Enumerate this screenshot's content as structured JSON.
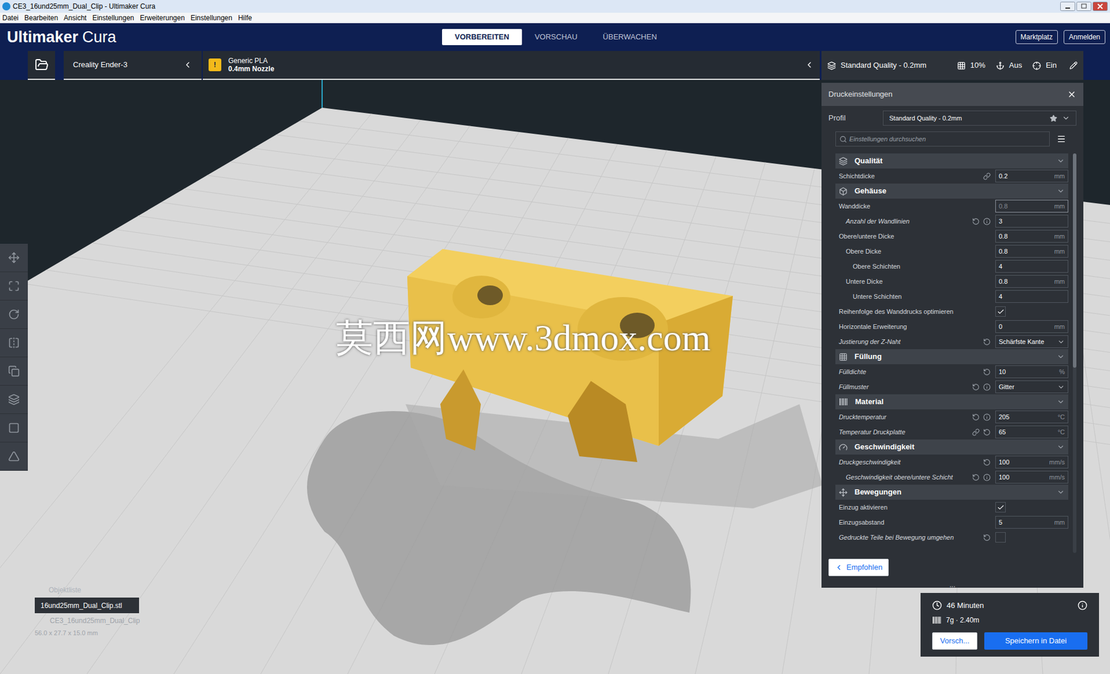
{
  "window": {
    "title": "CE3_16und25mm_Dual_Clip - Ultimaker Cura"
  },
  "menu": [
    "Datei",
    "Bearbeiten",
    "Ansicht",
    "Einstellungen",
    "Erweiterungen",
    "Einstellungen",
    "Hilfe"
  ],
  "header": {
    "logo_bold": "Ultimaker",
    "logo_light": "Cura",
    "stages": [
      {
        "label": "VORBEREITEN",
        "selected": true
      },
      {
        "label": "VORSCHAU",
        "selected": false
      },
      {
        "label": "ÜBERWACHEN",
        "selected": false
      }
    ],
    "buttons": [
      "Marktplatz",
      "Anmelden"
    ]
  },
  "printer": {
    "machine": "Creality Ender-3",
    "material": "Generic PLA",
    "nozzle": "0.4mm Nozzle",
    "warning_glyph": "!"
  },
  "summary": {
    "profile": "Standard Quality - 0.2mm",
    "infill": "10%",
    "support": "Aus",
    "adhesion": "Ein"
  },
  "settings_panel": {
    "title": "Druckeinstellungen",
    "profile_label": "Profil",
    "profile_value": "Standard Quality - 0.2mm",
    "search_placeholder": "Einstellungen durchsuchen",
    "recommended_button": "Empfohlen",
    "handle": "...",
    "categories": [
      {
        "name": "Qualität",
        "expanded": true,
        "rows": [
          {
            "label": "Schichtdicke",
            "kind": "number",
            "value": "0.2",
            "unit": "mm",
            "italic": false,
            "depth": 0,
            "link": true,
            "reset": false,
            "info": false
          }
        ]
      },
      {
        "name": "Gehäuse",
        "expanded": true,
        "rows": [
          {
            "label": "Wanddicke",
            "kind": "number",
            "value": "0.8",
            "unit": "mm",
            "italic": false,
            "depth": 0,
            "link": false,
            "reset": false,
            "info": false,
            "dimmed": true
          },
          {
            "label": "Anzahl der Wandlinien",
            "kind": "number",
            "value": "3",
            "unit": "",
            "italic": true,
            "depth": 1,
            "link": false,
            "reset": true,
            "info": true
          },
          {
            "label": "Obere/untere Dicke",
            "kind": "number",
            "value": "0.8",
            "unit": "mm",
            "italic": false,
            "depth": 0,
            "link": false,
            "reset": false,
            "info": false
          },
          {
            "label": "Obere Dicke",
            "kind": "number",
            "value": "0.8",
            "unit": "mm",
            "italic": false,
            "depth": 1,
            "link": false,
            "reset": false,
            "info": false
          },
          {
            "label": "Obere Schichten",
            "kind": "number",
            "value": "4",
            "unit": "",
            "italic": false,
            "depth": 2,
            "link": false,
            "reset": false,
            "info": false
          },
          {
            "label": "Untere Dicke",
            "kind": "number",
            "value": "0.8",
            "unit": "mm",
            "italic": false,
            "depth": 1,
            "link": false,
            "reset": false,
            "info": false
          },
          {
            "label": "Untere Schichten",
            "kind": "number",
            "value": "4",
            "unit": "",
            "italic": false,
            "depth": 2,
            "link": false,
            "reset": false,
            "info": false
          },
          {
            "label": "Reihenfolge des Wanddrucks optimieren",
            "kind": "check",
            "checked": true,
            "italic": false,
            "depth": 0,
            "link": false,
            "reset": false,
            "info": false
          },
          {
            "label": "Horizontale Erweiterung",
            "kind": "number",
            "value": "0",
            "unit": "mm",
            "italic": false,
            "depth": 0,
            "link": false,
            "reset": false,
            "info": false
          },
          {
            "label": "Justierung der Z-Naht",
            "kind": "select",
            "value": "Schärfste Kante",
            "italic": true,
            "depth": 0,
            "link": false,
            "reset": true,
            "info": false
          }
        ]
      },
      {
        "name": "Füllung",
        "expanded": true,
        "rows": [
          {
            "label": "Fülldichte",
            "kind": "number",
            "value": "10",
            "unit": "%",
            "italic": true,
            "depth": 0,
            "link": false,
            "reset": true,
            "info": false
          },
          {
            "label": "Füllmuster",
            "kind": "select",
            "value": "Gitter",
            "italic": true,
            "depth": 0,
            "link": false,
            "reset": true,
            "info": true
          }
        ]
      },
      {
        "name": "Material",
        "expanded": true,
        "rows": [
          {
            "label": "Drucktemperatur",
            "kind": "number",
            "value": "205",
            "unit": "°C",
            "italic": true,
            "depth": 0,
            "link": false,
            "reset": true,
            "info": true
          },
          {
            "label": "Temperatur Druckplatte",
            "kind": "number",
            "value": "65",
            "unit": "°C",
            "italic": true,
            "depth": 0,
            "link": true,
            "reset": true,
            "info": false
          }
        ]
      },
      {
        "name": "Geschwindigkeit",
        "expanded": true,
        "rows": [
          {
            "label": "Druckgeschwindigkeit",
            "kind": "number",
            "value": "100",
            "unit": "mm/s",
            "italic": true,
            "depth": 0,
            "link": false,
            "reset": true,
            "info": false
          },
          {
            "label": "Geschwindigkeit obere/untere Schicht",
            "kind": "number",
            "value": "100",
            "unit": "mm/s",
            "italic": true,
            "depth": 1,
            "link": false,
            "reset": true,
            "info": true
          }
        ]
      },
      {
        "name": "Bewegungen",
        "expanded": true,
        "rows": [
          {
            "label": "Einzug aktivieren",
            "kind": "check",
            "checked": true,
            "italic": false,
            "depth": 0,
            "link": false,
            "reset": false,
            "info": false
          },
          {
            "label": "Einzugsabstand",
            "kind": "number",
            "value": "5",
            "unit": "mm",
            "italic": false,
            "depth": 0,
            "link": false,
            "reset": false,
            "info": false
          },
          {
            "label": "Gedruckte Teile bei Bewegung umgehen",
            "kind": "check",
            "checked": false,
            "italic": true,
            "depth": 0,
            "link": false,
            "reset": true,
            "info": false
          }
        ]
      }
    ]
  },
  "viewport": {
    "watermark": "莫西网www.3dmox.com"
  },
  "objects": {
    "title": "Objektliste",
    "items": [
      {
        "name": "16und25mm_Dual_Clip.stl",
        "selected": true
      }
    ],
    "name": "CE3_16und25mm_Dual_Clip",
    "dimensions": "56.0 x 27.7 x 15.0 mm"
  },
  "estimate": {
    "time": "46 Minuten",
    "material": "7g · 2.40m",
    "buttons": [
      "Vorsch...",
      "Speichern in Datei"
    ]
  }
}
